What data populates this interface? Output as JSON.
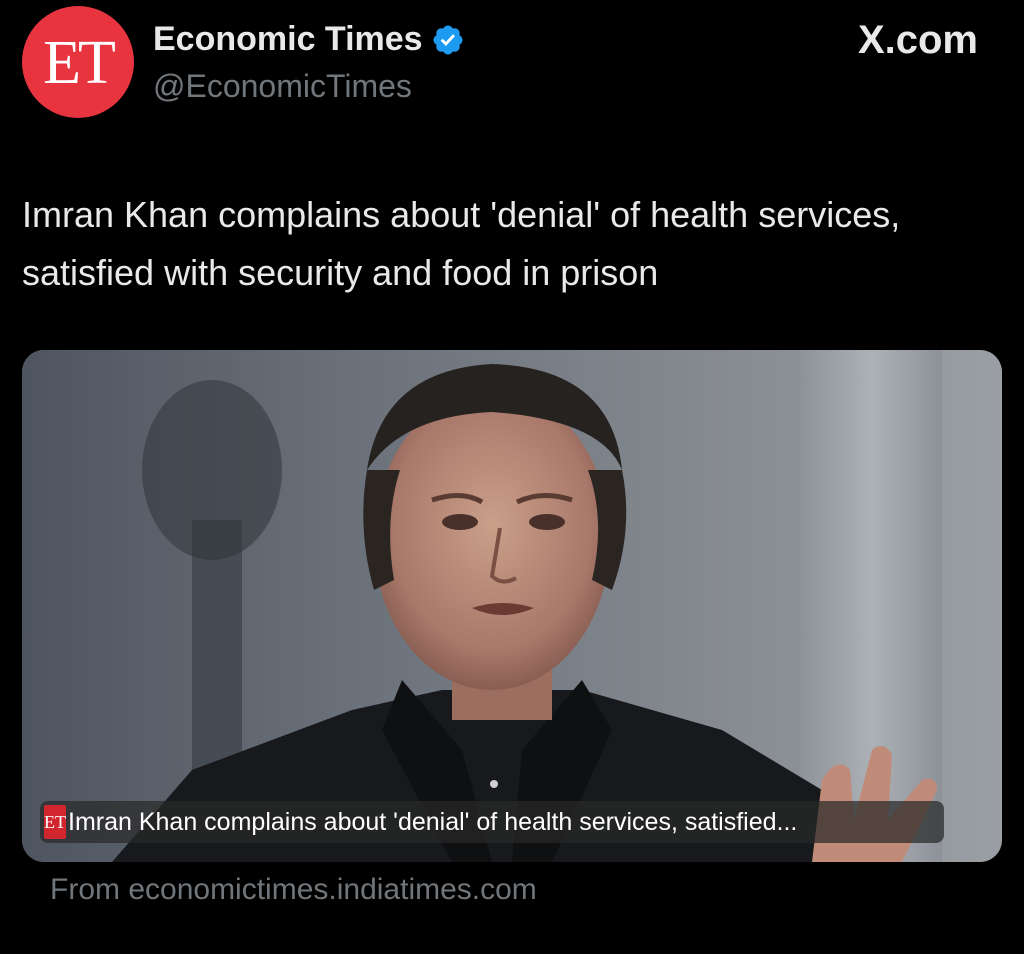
{
  "account": {
    "avatar_text": "ET",
    "display_name": "Economic Times",
    "handle": "@EconomicTimes",
    "verified_icon": "verified-badge-icon"
  },
  "brand": {
    "label": "X.com"
  },
  "tweet": {
    "text": "Imran Khan complains about 'denial' of health services, satisfied with security and food in prison"
  },
  "card": {
    "image_icon": "article-photo",
    "caption_logo": "ET",
    "caption": "Imran Khan complains about 'denial' of health services, satisfied...",
    "source": "From economictimes.indiatimes.com"
  },
  "colors": {
    "background": "#000000",
    "text_primary": "#e7e9ea",
    "text_secondary": "#71767b",
    "avatar": "#e8343f",
    "verified": "#1d9bf0"
  }
}
